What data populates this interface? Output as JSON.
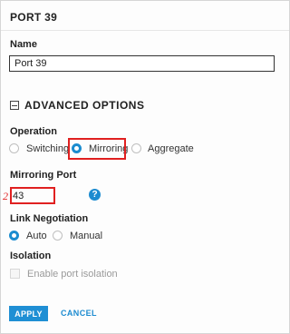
{
  "panel": {
    "title": "PORT 39"
  },
  "name_field": {
    "label": "Name",
    "value": "Port 39"
  },
  "advanced": {
    "header": "ADVANCED OPTIONS"
  },
  "operation": {
    "label": "Operation",
    "options": [
      {
        "label": "Switching",
        "selected": false
      },
      {
        "label": "Mirroring",
        "selected": true
      },
      {
        "label": "Aggregate",
        "selected": false
      }
    ]
  },
  "mirroring_port": {
    "label": "Mirroring Port",
    "value": "43",
    "help_icon": "?"
  },
  "link_negotiation": {
    "label": "Link Negotiation",
    "options": [
      {
        "label": "Auto",
        "selected": true
      },
      {
        "label": "Manual",
        "selected": false
      }
    ]
  },
  "isolation": {
    "label": "Isolation",
    "checkbox_label": "Enable port isolation",
    "checked": false
  },
  "actions": {
    "apply": "APPLY",
    "cancel": "CANCEL"
  },
  "annotations": {
    "step_number": "2",
    "highlight_color": "#e02020"
  },
  "colors": {
    "accent": "#1c8bd0"
  }
}
